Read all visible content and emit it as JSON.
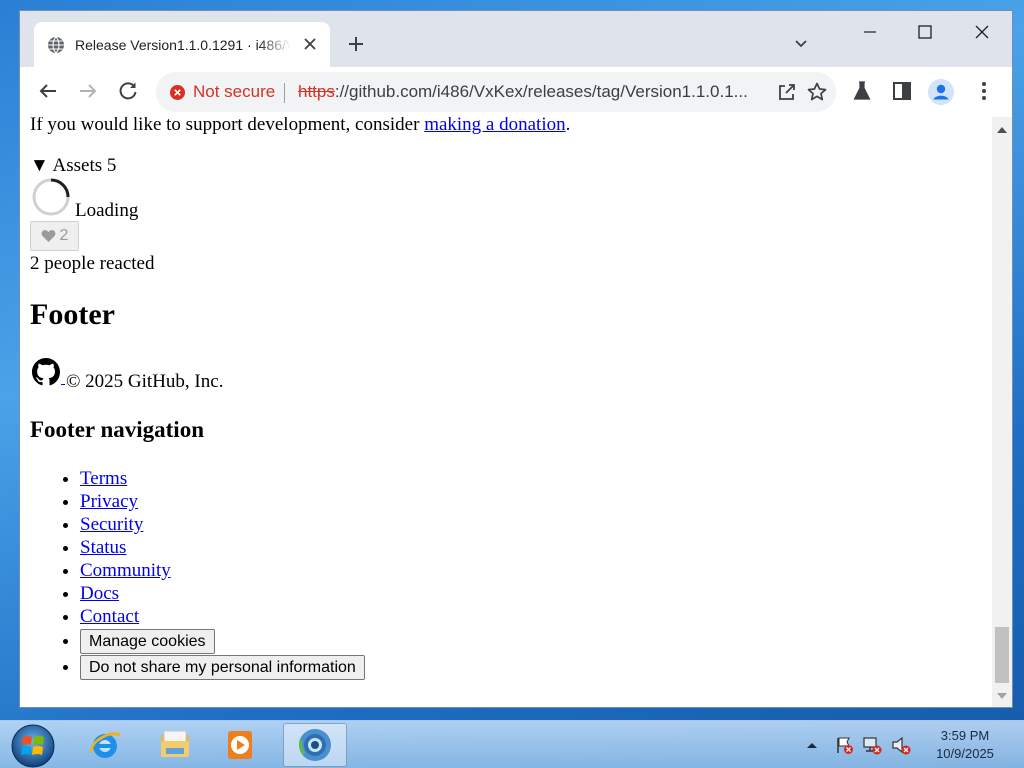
{
  "browser": {
    "tab": {
      "title": "Release Version1.1.0.1291 · i486/VxKex"
    },
    "omnibox": {
      "security_label": "Not secure",
      "url_scheme": "https",
      "url_rest": "://github.com/i486/VxKex/releases/tag/Version1.1.0.1..."
    },
    "accent": "#1a73e8"
  },
  "page": {
    "donation_text": "If you would like to support development, consider ",
    "donation_link": "making a donation",
    "donation_end": ".",
    "assets_label": "▼ Assets 5",
    "loading_label": "Loading",
    "reaction_count": "2",
    "reacted_text": "2 people reacted",
    "footer_heading": "Footer",
    "copyright": "© 2025 GitHub, Inc.",
    "footer_nav_heading": "Footer navigation",
    "footer_links": [
      "Terms",
      "Privacy",
      "Security",
      "Status",
      "Community",
      "Docs",
      "Contact"
    ],
    "footer_buttons": [
      "Manage cookies",
      "Do not share my personal information"
    ]
  },
  "taskbar": {
    "apps": [
      "internet-explorer",
      "file-explorer",
      "media-player",
      "chrome"
    ],
    "clock_time": "3:59 PM",
    "clock_date": "10/9/2025"
  }
}
